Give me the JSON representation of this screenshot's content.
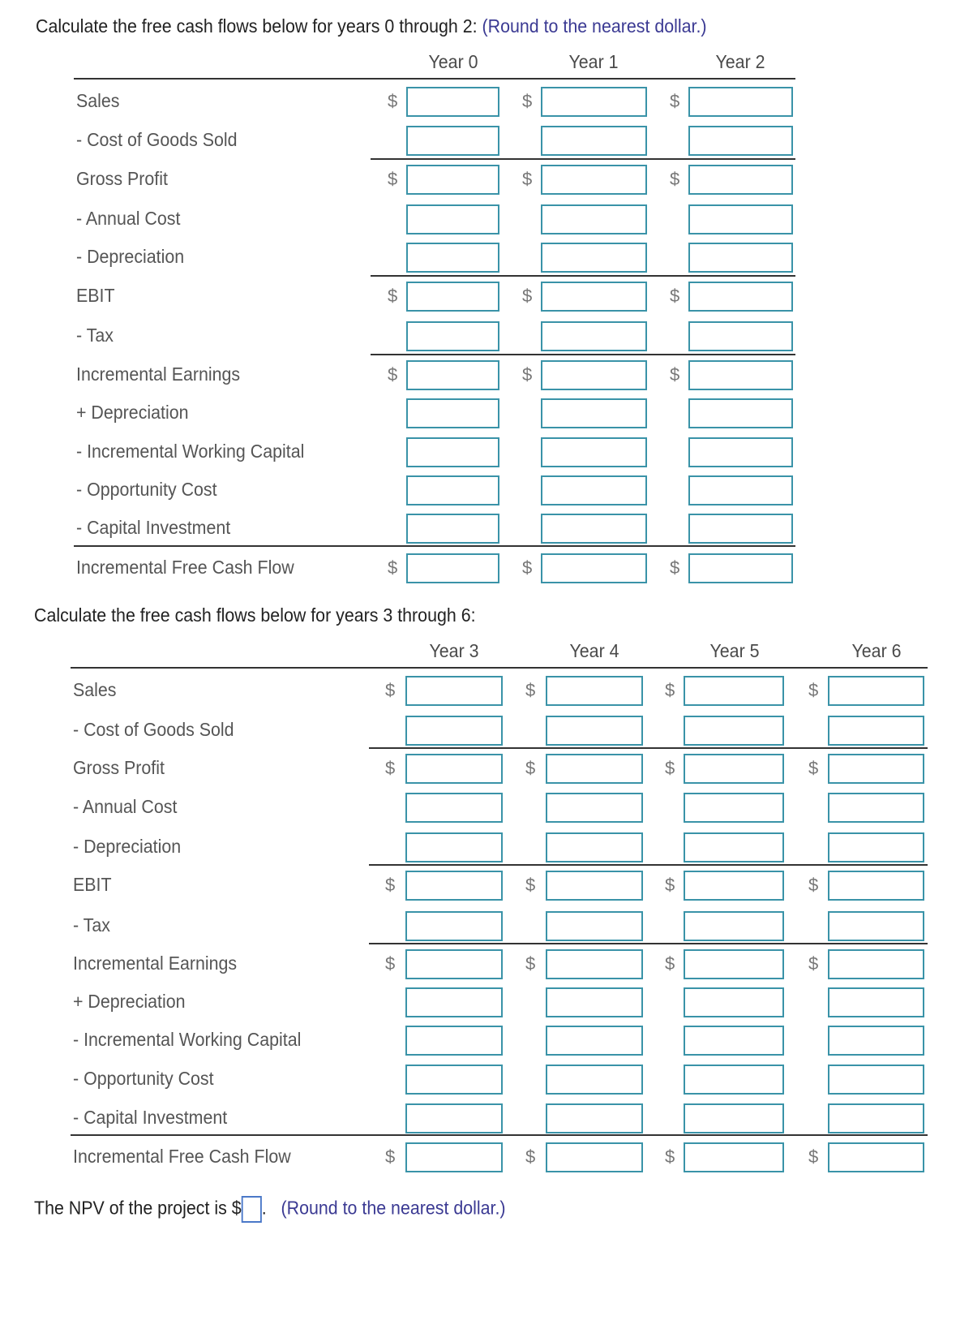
{
  "section1": {
    "instruction": "Calculate the free cash flows below for years 0 through 2:",
    "hint": "(Round to the nearest dollar.)",
    "columns": [
      "Year 0",
      "Year 1",
      "Year 2"
    ]
  },
  "section2": {
    "instruction": "Calculate the free cash flows below for years 3 through 6:",
    "columns": [
      "Year 3",
      "Year 4",
      "Year 5",
      "Year 6"
    ]
  },
  "rows": [
    {
      "label": "Sales",
      "dollar": true
    },
    {
      "label": "- Cost of Goods Sold",
      "dollar": false
    },
    {
      "label": "Gross Profit",
      "dollar": true
    },
    {
      "label": "- Annual Cost",
      "dollar": false
    },
    {
      "label": "- Depreciation",
      "dollar": false
    },
    {
      "label": "EBIT",
      "dollar": true
    },
    {
      "label": "- Tax",
      "dollar": false
    },
    {
      "label": "Incremental Earnings",
      "dollar": true
    },
    {
      "label": "+ Depreciation",
      "dollar": false
    },
    {
      "label": "- Incremental Working Capital",
      "dollar": false
    },
    {
      "label": "- Opportunity Cost",
      "dollar": false
    },
    {
      "label": "- Capital Investment",
      "dollar": false
    },
    {
      "label": "Incremental Free Cash Flow",
      "dollar": true
    }
  ],
  "currency_symbol": "$",
  "cell_values": "",
  "npv": {
    "prefix": "The NPV of the project is $",
    "value": "",
    "suffix": ".",
    "hint": "(Round to the nearest dollar.)"
  },
  "colors": {
    "input_border": "#3a93a8",
    "hint_text": "#3b3a93",
    "npv_border": "#4a78c8"
  }
}
